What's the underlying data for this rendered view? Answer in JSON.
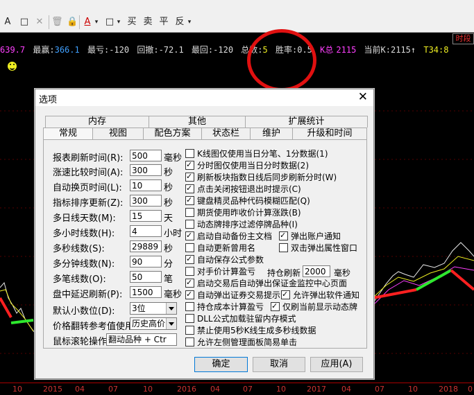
{
  "toolbar": {
    "items": [
      "A",
      "□",
      "✕",
      "🗑",
      "🔒",
      "A",
      "▾",
      "□",
      "▾",
      "买",
      "卖",
      "平",
      "反",
      "▾"
    ]
  },
  "time_button": "时段",
  "status": {
    "v1": "639.7",
    "l_maxwin": "最赢:",
    "v_maxwin": "366.1",
    "l_maxloss": "最亏:",
    "v_maxloss": "-120",
    "l_dd": "回撤:",
    "v_dd": "-72.1",
    "l_lastloss": "最回:",
    "v_lastloss": "-120",
    "l_total": "总数:",
    "v_total": "5",
    "l_win": "胜率:",
    "v_win": "0.5",
    "l_k": "K总",
    "v_k": "2115",
    "l_cur": "当前K:",
    "v_cur": "2115↑",
    "t34": "T34:",
    "v_t34": "8"
  },
  "colors": {
    "red": "#ff2020",
    "green": "#2ee82e",
    "yellow": "#e6e620",
    "magenta": "#ff40ff",
    "cyan": "#40c0ff"
  },
  "axis_labels": [
    "10",
    "2015",
    "04",
    "07",
    "10",
    "2016",
    "04",
    "07",
    "10",
    "2017",
    "04",
    "07",
    "10",
    "2018",
    "0"
  ],
  "dialog": {
    "title": "选项",
    "close": "✕",
    "tabs_row1": [
      "内存",
      "其他",
      "扩展统计"
    ],
    "tabs_row2": [
      "常规",
      "视图",
      "配色方案",
      "状态栏",
      "维护",
      "升级和时间"
    ],
    "fields": [
      {
        "label": "报表刷新时间(R):",
        "value": "500",
        "unit": "毫秒"
      },
      {
        "label": "涨速比较时间(A):",
        "value": "300",
        "unit": "秒"
      },
      {
        "label": "自动换页时间(L):",
        "value": "10",
        "unit": "秒"
      },
      {
        "label": "指标排序更新(Z):",
        "value": "300",
        "unit": "秒"
      },
      {
        "label": "多日线天数(M):",
        "value": "15",
        "unit": "天"
      },
      {
        "label": "多小时线数(H):",
        "value": "4",
        "unit": "小时"
      },
      {
        "label": "多秒线数(S):",
        "value": "29889",
        "unit": "秒"
      },
      {
        "label": "多分钟线数(N):",
        "value": "90",
        "unit": "分"
      },
      {
        "label": "多笔线数(O):",
        "value": "50",
        "unit": "笔"
      },
      {
        "label": "盘中延迟刷新(P):",
        "value": "1500",
        "unit": "毫秒"
      }
    ],
    "decimal_label": "默认小数位(D):",
    "decimal_value": "3位",
    "price_ref_label": "价格翻转参考值使用",
    "price_ref_value": "历史高价",
    "wheel_label": "鼠标滚轮操作",
    "wheel_value": "翻动品种 + Ctr",
    "checks": [
      {
        "label": "K线图仅使用当日分笔、1分数据(1)",
        "checked": false
      },
      {
        "label": "分时图仅使用当日分时数据(2)",
        "checked": true
      },
      {
        "label": "刷新板块指数日线后同步刷新分时(W)",
        "checked": true
      },
      {
        "label": "点击关闭按钮退出时提示(C)",
        "checked": true
      },
      {
        "label": "键盘精灵品种代码模糊匹配(Q)",
        "checked": true
      },
      {
        "label": "期货使用昨收价计算涨跌(B)",
        "checked": false
      },
      {
        "label": "动态牌排序过滤停牌品种(I)",
        "checked": false
      },
      {
        "label": "启动自动备份主文档",
        "checked": true
      },
      {
        "label": "自动更新曾用名",
        "checked": false
      },
      {
        "label": "自动保存公式参数",
        "checked": true
      },
      {
        "label": "对手价计算盈亏",
        "checked": false
      },
      {
        "label": "启动交易后自动弹出保证金监控中心页面",
        "checked": true
      },
      {
        "label": "自动弹出证券交易提示",
        "checked": true
      },
      {
        "label": "持仓成本计算盈亏",
        "checked": false
      },
      {
        "label": "DLL公式加载驻留内存模式",
        "checked": false
      },
      {
        "label": "禁止使用5秒K线生成多秒线数据",
        "checked": false
      },
      {
        "label": "允许左侧管理面板简易单击",
        "checked": false
      }
    ],
    "check_acct": {
      "label": "弹出账户通知",
      "checked": true
    },
    "check_dbl": {
      "label": "双击弹出属性窗口",
      "checked": false
    },
    "check_allow_popup": {
      "label": "允许弹出软件通知",
      "checked": true
    },
    "check_refresh_only": {
      "label": "仅刷当前显示动态牌",
      "checked": true
    },
    "hold_refresh_label": "持仓刷新",
    "hold_refresh_value": "2000",
    "hold_refresh_unit": "毫秒",
    "ok": "确定",
    "cancel": "取消",
    "apply": "应用(A)"
  }
}
